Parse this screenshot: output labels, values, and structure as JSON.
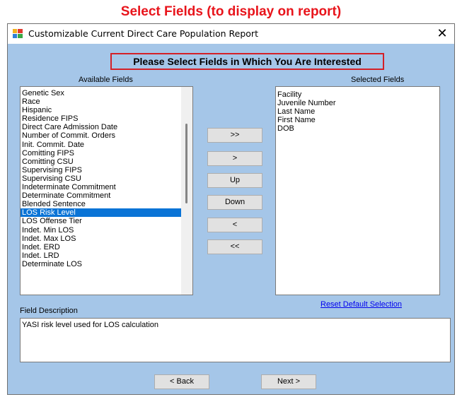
{
  "caption": "Select Fields (to display on report)",
  "window": {
    "title": "Customizable Current Direct Care Population Report",
    "close_glyph": "✕"
  },
  "header_text": "Please Select Fields in Which You Are Interested",
  "available": {
    "label": "Available Fields",
    "items": [
      "Genetic Sex",
      "Race",
      "Hispanic",
      "Residence FIPS",
      "Direct Care Admission Date",
      "Number of Commit. Orders",
      "Init. Commit. Date",
      "Comitting FIPS",
      "Comitting CSU",
      "Supervising FIPS",
      "Supervising CSU",
      "Indeterminate Commitment",
      "Determinate Commitment",
      "Blended Sentence",
      "LOS Risk Level",
      "LOS Offense Tier",
      "Indet. Min LOS",
      "Indet. Max LOS",
      "Indet. ERD",
      "Indet. LRD",
      "Determinate LOS"
    ],
    "selected_item": "LOS Risk Level"
  },
  "selected": {
    "label": "Selected Fields",
    "items": [
      "Facility",
      "Juvenile Number",
      "Last Name",
      "First Name",
      "DOB"
    ]
  },
  "buttons": {
    "add_all": ">>",
    "add": ">",
    "up": "Up",
    "down": "Down",
    "remove": "<",
    "remove_all": "<<",
    "back": "< Back",
    "next": "Next >"
  },
  "reset_link": "Reset Default Selection",
  "field_description": {
    "label": "Field Description",
    "text": "YASI risk level used for LOS calculation"
  },
  "colors": {
    "caption": "#e8141b",
    "form_bg": "#a5c6e8",
    "selection": "#0a74d6",
    "header_border": "#d42027"
  }
}
